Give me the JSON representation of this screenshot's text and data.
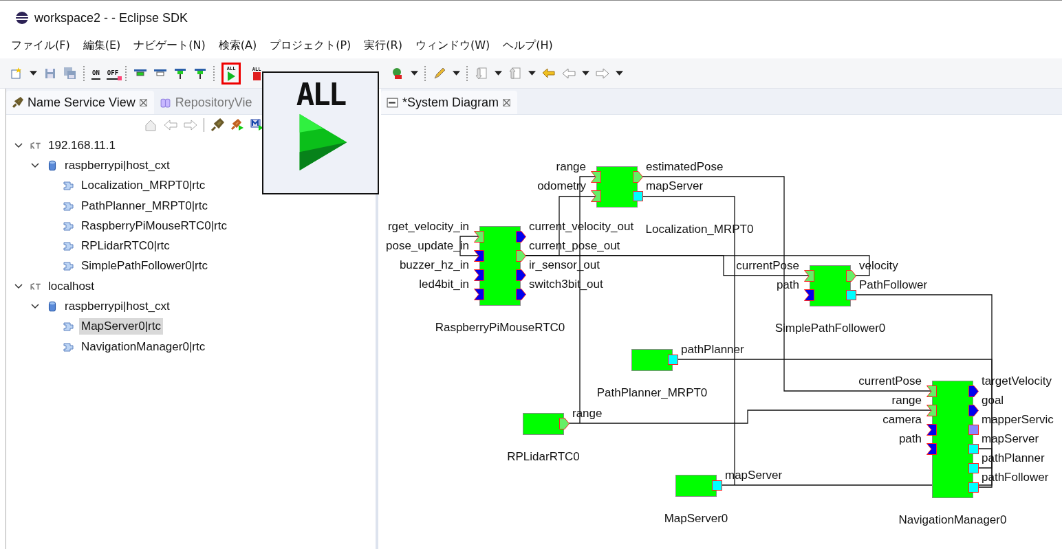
{
  "window": {
    "title": "workspace2 -  - Eclipse SDK"
  },
  "menu": [
    {
      "label": "ファイル(F)"
    },
    {
      "label": "編集(E)"
    },
    {
      "label": "ナビゲート(N)"
    },
    {
      "label": "検索(A)"
    },
    {
      "label": "プロジェクト(P)"
    },
    {
      "label": "実行(R)"
    },
    {
      "label": "ウィンドウ(W)"
    },
    {
      "label": "ヘルプ(H)"
    }
  ],
  "toolbar": [
    {
      "kind": "new"
    },
    {
      "kind": "caret"
    },
    {
      "kind": "save"
    },
    {
      "kind": "save-all"
    },
    {
      "kind": "sep"
    },
    {
      "kind": "on",
      "label": "ON"
    },
    {
      "kind": "off",
      "label": "OFF"
    },
    {
      "kind": "sep"
    },
    {
      "kind": "bar-active"
    },
    {
      "kind": "bar-inactive"
    },
    {
      "kind": "pin"
    },
    {
      "kind": "pin"
    },
    {
      "kind": "sep"
    },
    {
      "kind": "start-all",
      "label": "ALL",
      "highlighted": true
    },
    {
      "kind": "stop-all",
      "label": "ALL",
      "highlighted": false
    },
    {
      "kind": "globe"
    },
    {
      "kind": "caret"
    },
    {
      "kind": "sep"
    },
    {
      "kind": "pen"
    },
    {
      "kind": "caret"
    },
    {
      "kind": "sep"
    },
    {
      "kind": "down-doc"
    },
    {
      "kind": "caret"
    },
    {
      "kind": "up-doc"
    },
    {
      "kind": "caret"
    },
    {
      "kind": "back"
    },
    {
      "kind": "left"
    },
    {
      "kind": "caret"
    },
    {
      "kind": "right"
    },
    {
      "kind": "caret"
    }
  ],
  "left_tabs": [
    {
      "label": "Name Service View",
      "selected": true,
      "closable": true
    },
    {
      "label": "RepositoryVie",
      "selected": false,
      "closable": false
    }
  ],
  "name_service_toolbar": [
    {
      "kind": "home"
    },
    {
      "kind": "left"
    },
    {
      "kind": "right"
    },
    {
      "kind": "sep"
    },
    {
      "kind": "plug"
    },
    {
      "kind": "plug-run"
    },
    {
      "kind": "m-run"
    }
  ],
  "tree": [
    {
      "label": "192.168.11.1",
      "kind": "host",
      "expanded": true,
      "selected": false,
      "children": [
        {
          "label": "raspberrypi|host_cxt",
          "kind": "context",
          "expanded": true,
          "selected": false,
          "children": [
            {
              "label": "Localization_MRPT0|rtc",
              "kind": "rtc",
              "selected": false
            },
            {
              "label": "PathPlanner_MRPT0|rtc",
              "kind": "rtc",
              "selected": false
            },
            {
              "label": "RaspberryPiMouseRTC0|rtc",
              "kind": "rtc",
              "selected": false
            },
            {
              "label": "RPLidarRTC0|rtc",
              "kind": "rtc",
              "selected": false
            },
            {
              "label": "SimplePathFollower0|rtc",
              "kind": "rtc",
              "selected": false
            }
          ]
        }
      ]
    },
    {
      "label": "localhost",
      "kind": "host",
      "expanded": true,
      "selected": false,
      "children": [
        {
          "label": "raspberrypi|host_cxt",
          "kind": "context",
          "expanded": true,
          "selected": false,
          "children": [
            {
              "label": "MapServer0|rtc",
              "kind": "rtc",
              "selected": true
            },
            {
              "label": "NavigationManager0|rtc",
              "kind": "rtc",
              "selected": false
            }
          ]
        }
      ]
    }
  ],
  "editor_tabs": [
    {
      "label": "*System Diagram",
      "selected": true,
      "closable": true
    }
  ],
  "diagram": {
    "components": [
      {
        "name": "Localization_MRPT0",
        "inports": [
          {
            "name": "range",
            "kind": "data",
            "connected": true
          },
          {
            "name": "odometry",
            "kind": "data",
            "connected": true
          }
        ],
        "outports": [
          {
            "name": "estimatedPose",
            "kind": "data",
            "connected": true
          },
          {
            "name": "mapServer",
            "kind": "service",
            "connected": true
          }
        ]
      },
      {
        "name": "RaspberryPiMouseRTC0",
        "inports": [
          {
            "name": "rget_velocity_in",
            "kind": "data",
            "connected": true
          },
          {
            "name": "pose_update_in",
            "kind": "data",
            "connected": false
          },
          {
            "name": "buzzer_hz_in",
            "kind": "data",
            "connected": false
          },
          {
            "name": "led4bit_in",
            "kind": "data",
            "connected": false
          }
        ],
        "outports": [
          {
            "name": "current_velocity_out",
            "kind": "data",
            "connected": false
          },
          {
            "name": "current_pose_out",
            "kind": "data",
            "connected": true
          },
          {
            "name": "ir_sensor_out",
            "kind": "data",
            "connected": false
          },
          {
            "name": "switch3bit_out",
            "kind": "data",
            "connected": false
          }
        ]
      },
      {
        "name": "SimplePathFollower0",
        "inports": [
          {
            "name": "currentPose",
            "kind": "data",
            "connected": true
          },
          {
            "name": "path",
            "kind": "data",
            "connected": false
          }
        ],
        "outports": [
          {
            "name": "velocity",
            "kind": "data",
            "connected": true
          },
          {
            "name": "PathFollower",
            "kind": "service",
            "connected": true
          }
        ]
      },
      {
        "name": "PathPlanner_MRPT0",
        "outports": [
          {
            "name": "pathPlanner",
            "kind": "service",
            "connected": true
          }
        ]
      },
      {
        "name": "RPLidarRTC0",
        "outports": [
          {
            "name": "range",
            "kind": "data",
            "connected": true
          }
        ]
      },
      {
        "name": "MapServer0",
        "outports": [
          {
            "name": "mapServer",
            "kind": "service",
            "connected": true
          }
        ]
      },
      {
        "name": "NavigationManager0",
        "inports": [
          {
            "name": "currentPose",
            "kind": "data",
            "connected": true
          },
          {
            "name": "range",
            "kind": "data",
            "connected": true
          },
          {
            "name": "camera",
            "kind": "data",
            "connected": false
          },
          {
            "name": "path",
            "kind": "data",
            "connected": false
          }
        ],
        "outports": [
          {
            "name": "targetVelocity",
            "kind": "data",
            "connected": false
          },
          {
            "name": "goal",
            "kind": "data",
            "connected": false
          },
          {
            "name": "mapperServic",
            "kind": "service",
            "connected": false
          },
          {
            "name": "mapServer",
            "kind": "service",
            "connected": true
          },
          {
            "name": "pathPlanner",
            "kind": "service",
            "connected": true
          },
          {
            "name": "pathFollower",
            "kind": "service",
            "connected": true
          }
        ]
      }
    ]
  },
  "tooltip": {
    "text": "ALL"
  }
}
